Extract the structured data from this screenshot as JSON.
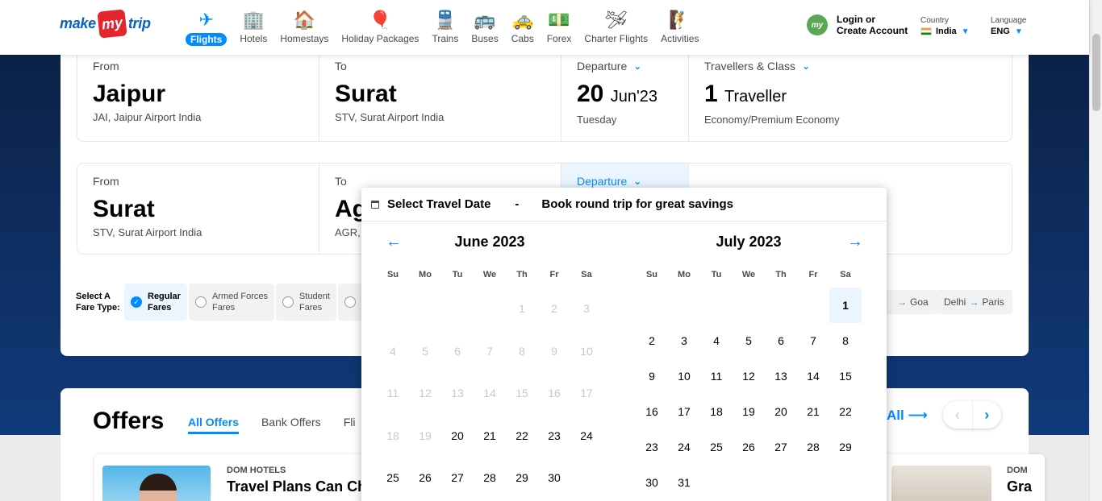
{
  "header": {
    "logo": {
      "make": "make",
      "my": "my",
      "trip": "trip"
    },
    "nav": [
      {
        "label": "Flights",
        "icon": "flight-icon",
        "glyph": "✈",
        "active": true
      },
      {
        "label": "Hotels",
        "icon": "hotel-icon",
        "glyph": "🏢"
      },
      {
        "label": "Homestays",
        "icon": "homestay-icon",
        "glyph": "🏠"
      },
      {
        "label": "Holiday Packages",
        "icon": "holiday-icon",
        "glyph": "🎈"
      },
      {
        "label": "Trains",
        "icon": "train-icon",
        "glyph": "🚆"
      },
      {
        "label": "Buses",
        "icon": "bus-icon",
        "glyph": "🚌"
      },
      {
        "label": "Cabs",
        "icon": "cab-icon",
        "glyph": "🚕"
      },
      {
        "label": "Forex",
        "icon": "forex-icon",
        "glyph": "💵"
      },
      {
        "label": "Charter Flights",
        "icon": "charter-icon",
        "glyph": "🛩"
      },
      {
        "label": "Activities",
        "icon": "activities-icon",
        "glyph": "🧗"
      }
    ],
    "login_line1": "Login or",
    "login_line2": "Create Account",
    "country_label": "Country",
    "country_value": "India",
    "language_label": "Language",
    "language_value": "ENG"
  },
  "search": {
    "row1": {
      "from_label": "From",
      "from_city": "Jaipur",
      "from_airport": "JAI, Jaipur Airport India",
      "to_label": "To",
      "to_city": "Surat",
      "to_airport": "STV, Surat Airport India",
      "dep_label": "Departure",
      "dep_day": "20",
      "dep_month": "Jun'23",
      "dep_weekday": "Tuesday",
      "trav_label": "Travellers & Class",
      "trav_count": "1",
      "trav_word": "Traveller",
      "trav_class": "Economy/Premium Economy"
    },
    "row2": {
      "from_label": "From",
      "from_city": "Surat",
      "from_airport": "STV, Surat Airport India",
      "to_label": "To",
      "to_city": "Ag",
      "to_airport": "AGR,",
      "dep_label": "Departure"
    },
    "fare_title": "Select A Fare Type:",
    "fares": [
      {
        "line1": "Regular",
        "line2": "Fares",
        "selected": true
      },
      {
        "line1": "Armed Forces",
        "line2": "Fares"
      },
      {
        "line1": "Student",
        "line2": "Fares"
      }
    ],
    "trending": [
      {
        "from": "",
        "to": "Goa"
      },
      {
        "from": "Delhi",
        "to": "Paris"
      }
    ]
  },
  "offers": {
    "title": "Offers",
    "tabs": [
      "All Offers",
      "Bank Offers",
      "Fli"
    ],
    "view_all": "All",
    "card1_kicker": "DOM HOTELS",
    "card1_head": "Travel Plans Can Cha",
    "card2_kicker": "DOM",
    "card2_head": "Gra"
  },
  "calendar": {
    "title": "Select Travel Date",
    "separator": "-",
    "subtitle": "Book round trip for great savings",
    "weekdays": [
      "Su",
      "Mo",
      "Tu",
      "We",
      "Th",
      "Fr",
      "Sa"
    ],
    "months": [
      {
        "name": "June 2023",
        "weeks": [
          [
            "",
            "",
            "",
            "",
            "1",
            "2",
            "3"
          ],
          [
            "4",
            "5",
            "6",
            "7",
            "8",
            "9",
            "10"
          ],
          [
            "11",
            "12",
            "13",
            "14",
            "15",
            "16",
            "17"
          ],
          [
            "18",
            "19",
            "20",
            "21",
            "22",
            "23",
            "24"
          ],
          [
            "25",
            "26",
            "27",
            "28",
            "29",
            "30",
            ""
          ]
        ],
        "disabled_through": 19
      },
      {
        "name": "July 2023",
        "weeks": [
          [
            "",
            "",
            "",
            "",
            "",
            "",
            "1"
          ],
          [
            "2",
            "3",
            "4",
            "5",
            "6",
            "7",
            "8"
          ],
          [
            "9",
            "10",
            "11",
            "12",
            "13",
            "14",
            "15"
          ],
          [
            "16",
            "17",
            "18",
            "19",
            "20",
            "21",
            "22"
          ],
          [
            "23",
            "24",
            "25",
            "26",
            "27",
            "28",
            "29"
          ],
          [
            "30",
            "31",
            "",
            "",
            "",
            "",
            ""
          ]
        ],
        "selected": "1"
      }
    ]
  },
  "colors": {
    "brand_blue": "#008cff",
    "logo_red": "#e4252b",
    "dark_bg": "#0f2f63"
  }
}
